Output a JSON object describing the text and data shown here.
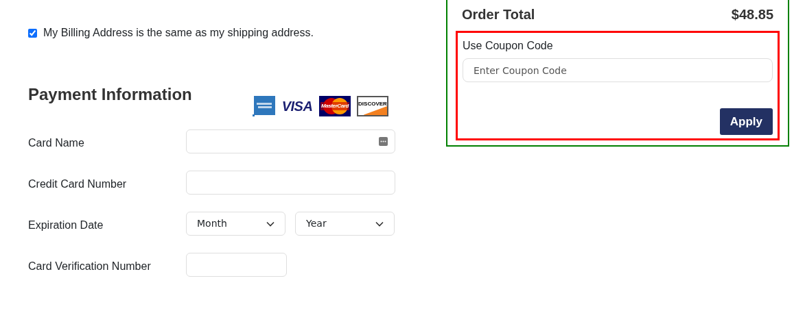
{
  "billing_same": {
    "label": "My Billing Address is the same as my shipping address.",
    "checked": true
  },
  "payment": {
    "title": "Payment Information",
    "card_logos": [
      {
        "kind": "amex"
      },
      {
        "kind": "visa",
        "label": "VISA"
      },
      {
        "kind": "mastercard",
        "label": "MasterCard"
      },
      {
        "kind": "discover",
        "label": "DISCOVER"
      }
    ],
    "fields": [
      {
        "label": "Card Name",
        "kind": "text",
        "autofill_icon": true
      },
      {
        "label": "Credit Card Number",
        "kind": "text",
        "autofill_icon": false
      },
      {
        "label": "Expiration Date",
        "kind": "selects",
        "selects": [
          "Month",
          "Year"
        ]
      },
      {
        "label": "Card Verification Number",
        "kind": "short"
      }
    ]
  },
  "order": {
    "total_label": "Order Total",
    "total_value": "$48.85",
    "coupon": {
      "label": "Use Coupon Code",
      "placeholder": "Enter Coupon Code",
      "button": "Apply"
    }
  }
}
